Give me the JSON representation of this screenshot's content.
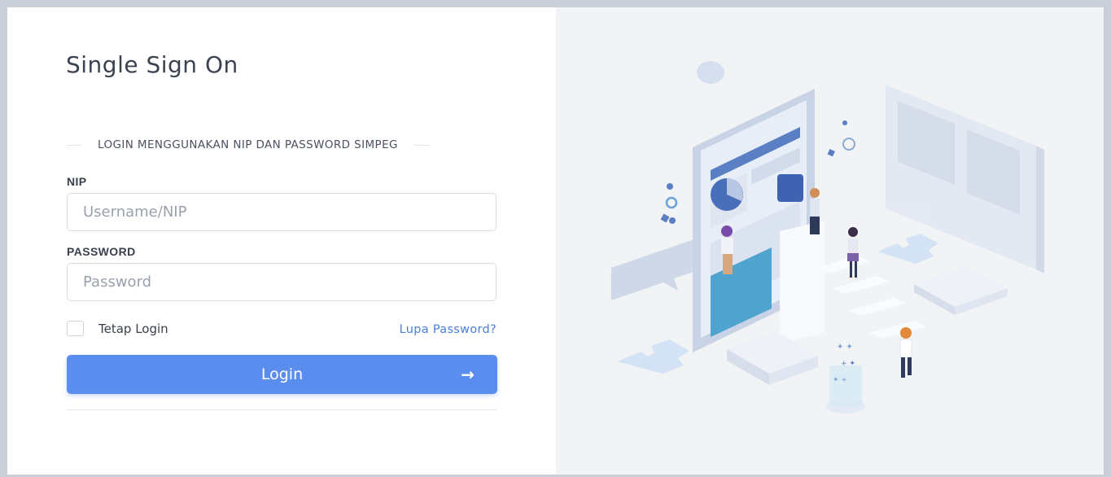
{
  "page": {
    "title": "Single Sign On"
  },
  "form": {
    "section_label": "LOGIN MENGGUNAKAN NIP DAN PASSWORD SIMPEG",
    "nip": {
      "label": "NIP",
      "placeholder": "Username/NIP",
      "value": ""
    },
    "password": {
      "label": "PASSWORD",
      "placeholder": "Password",
      "value": ""
    },
    "remember_label": "Tetap Login",
    "remember_checked": false,
    "forgot_label": "Lupa Password?",
    "submit_label": "Login",
    "submit_icon": "arrow-right-icon"
  },
  "colors": {
    "primary": "#5b8def",
    "link": "#4a80d8",
    "panel_bg": "#f1f3f4"
  }
}
